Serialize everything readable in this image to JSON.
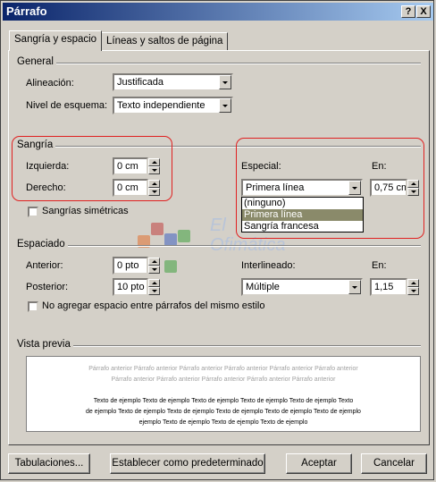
{
  "window": {
    "title": "Párrafo",
    "help_btn": "?",
    "close_btn": "X"
  },
  "tabs": [
    {
      "label": "Sangría y espacio",
      "active": true
    },
    {
      "label": "Líneas y saltos de página",
      "active": false
    }
  ],
  "general": {
    "section": "General",
    "alineacion_label": "Alineación:",
    "alineacion_value": "Justificada",
    "nivel_label": "Nivel de esquema:",
    "nivel_value": "Texto independiente"
  },
  "sangria": {
    "section": "Sangría",
    "izquierda_label": "Izquierda:",
    "izquierda_value": "0 cm",
    "derecho_label": "Derecho:",
    "derecho_value": "0 cm",
    "especial_label": "Especial:",
    "especial_value": "Primera línea",
    "especial_options": [
      "(ninguno)",
      "Primera línea",
      "Sangría francesa"
    ],
    "en_label": "En:",
    "en_value": "0,75 cm",
    "simetricas_label": "Sangrías simétricas",
    "simetricas_checked": false
  },
  "espaciado": {
    "section": "Espaciado",
    "anterior_label": "Anterior:",
    "anterior_value": "0 pto",
    "posterior_label": "Posterior:",
    "posterior_value": "10 pto",
    "interlineado_label": "Interlineado:",
    "interlineado_value": "Múltiple",
    "en_label": "En:",
    "en_value": "1,15",
    "no_agregar_label": "No agregar espacio entre párrafos del mismo estilo",
    "no_agregar_checked": false
  },
  "vista_previa": {
    "section": "Vista previa",
    "prev_line1": "Párrafo anterior Párrafo anterior Párrafo anterior Párrafo anterior Párrafo anterior Párrafo anterior",
    "prev_line2": "Párrafo anterior Párrafo anterior Párrafo anterior Párrafo anterior Párrafo anterior",
    "sample_line1": "Texto de ejemplo Texto de ejemplo Texto de ejemplo Texto de ejemplo Texto de ejemplo Texto",
    "sample_line2": "de ejemplo Texto de ejemplo Texto de ejemplo Texto de ejemplo Texto de ejemplo Texto de ejemplo",
    "sample_line3": "ejemplo Texto de ejemplo Texto de ejemplo Texto de ejemplo"
  },
  "watermark": {
    "line1": "El",
    "line2": "Ofimática"
  },
  "buttons": {
    "tabulaciones": "Tabulaciones...",
    "predeterminado": "Establecer como predeterminado",
    "aceptar": "Aceptar",
    "cancelar": "Cancelar"
  },
  "colors": {
    "titlebar_start": "#0a246a",
    "titlebar_end": "#a6caf0",
    "annotation_red": "#e02020",
    "face": "#d4d0c8"
  }
}
